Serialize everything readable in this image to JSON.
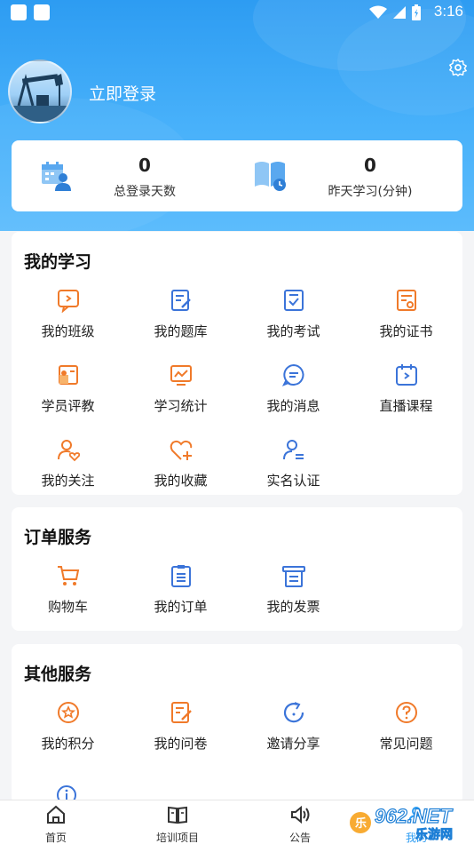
{
  "status_bar": {
    "time": "3:16"
  },
  "profile": {
    "login_text": "立即登录"
  },
  "stats": [
    {
      "value": "0",
      "label": "总登录天数",
      "icon": "calendar-user-icon"
    },
    {
      "value": "0",
      "label": "昨天学习(分钟)",
      "icon": "book-clock-icon"
    }
  ],
  "my_study": {
    "title": "我的学习",
    "items": [
      {
        "label": "我的班级",
        "icon": "class-icon"
      },
      {
        "label": "我的题库",
        "icon": "question-bank-icon"
      },
      {
        "label": "我的考试",
        "icon": "exam-icon"
      },
      {
        "label": "我的证书",
        "icon": "certificate-icon"
      },
      {
        "label": "学员评教",
        "icon": "evaluation-icon"
      },
      {
        "label": "学习统计",
        "icon": "statistics-icon"
      },
      {
        "label": "我的消息",
        "icon": "message-icon"
      },
      {
        "label": "直播课程",
        "icon": "live-course-icon"
      },
      {
        "label": "我的关注",
        "icon": "follow-icon"
      },
      {
        "label": "我的收藏",
        "icon": "favorite-icon"
      },
      {
        "label": "实名认证",
        "icon": "verify-icon"
      }
    ]
  },
  "order_service": {
    "title": "订单服务",
    "items": [
      {
        "label": "购物车",
        "icon": "cart-icon"
      },
      {
        "label": "我的订单",
        "icon": "order-icon"
      },
      {
        "label": "我的发票",
        "icon": "invoice-icon"
      }
    ]
  },
  "other_service": {
    "title": "其他服务",
    "items": [
      {
        "label": "我的积分",
        "icon": "points-icon"
      },
      {
        "label": "我的问卷",
        "icon": "survey-icon"
      },
      {
        "label": "邀请分享",
        "icon": "share-icon"
      },
      {
        "label": "常见问题",
        "icon": "faq-icon"
      }
    ]
  },
  "bottom_nav": [
    {
      "label": "首页",
      "icon": "home-icon"
    },
    {
      "label": "培训项目",
      "icon": "training-icon"
    },
    {
      "label": "公告",
      "icon": "announcement-icon"
    },
    {
      "label": "我的",
      "icon": "profile-icon"
    }
  ],
  "watermark": {
    "text_top": "962.NET",
    "text_bottom": "乐游网"
  },
  "colors": {
    "header_blue": "#2d9cf2",
    "icon_orange": "#f07a2a",
    "icon_blue": "#3b74d9"
  }
}
